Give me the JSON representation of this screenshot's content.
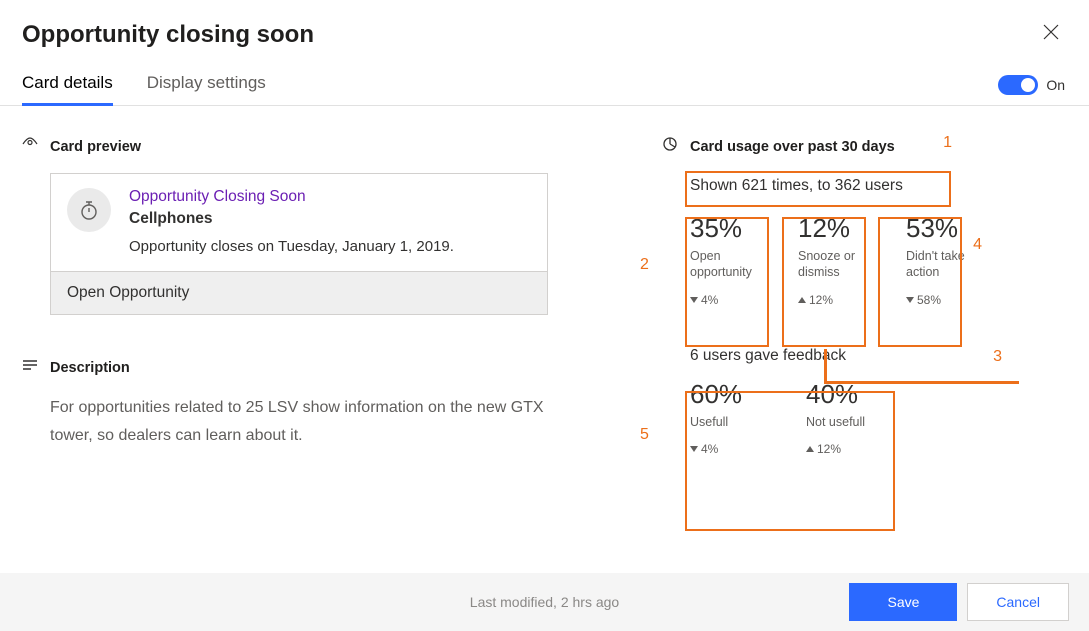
{
  "page_title": "Opportunity closing soon",
  "tabs": {
    "card_details": "Card details",
    "display_settings": "Display settings"
  },
  "toggle": {
    "state": "On"
  },
  "card_preview": {
    "section_label": "Card preview",
    "title": "Opportunity Closing Soon",
    "subject": "Cellphones",
    "body": "Opportunity closes on Tuesday, January 1, 2019.",
    "action": "Open Opportunity"
  },
  "description": {
    "section_label": "Description",
    "text": "For opportunities related to 25 LSV show information on the new GTX tower, so dealers can learn about it."
  },
  "usage": {
    "section_label": "Card usage over past 30 days",
    "shown_line": "Shown 621 times, to 362 users",
    "stats": [
      {
        "pct": "35%",
        "label": "Open opportunity",
        "delta_dir": "down",
        "delta": "4%"
      },
      {
        "pct": "12%",
        "label": "Snooze or dismiss",
        "delta_dir": "up",
        "delta": "12%"
      },
      {
        "pct": "53%",
        "label": "Didn't take action",
        "delta_dir": "down",
        "delta": "58%"
      }
    ],
    "feedback_line": "6 users gave feedback",
    "feedback_stats": [
      {
        "pct": "60%",
        "label": "Usefull",
        "delta_dir": "down",
        "delta": "4%"
      },
      {
        "pct": "40%",
        "label": "Not usefull",
        "delta_dir": "up",
        "delta": "12%"
      }
    ]
  },
  "annotations": {
    "n1": "1",
    "n2": "2",
    "n3": "3",
    "n4": "4",
    "n5": "5"
  },
  "footer": {
    "last_modified": "Last modified, 2 hrs ago",
    "save": "Save",
    "cancel": "Cancel"
  }
}
